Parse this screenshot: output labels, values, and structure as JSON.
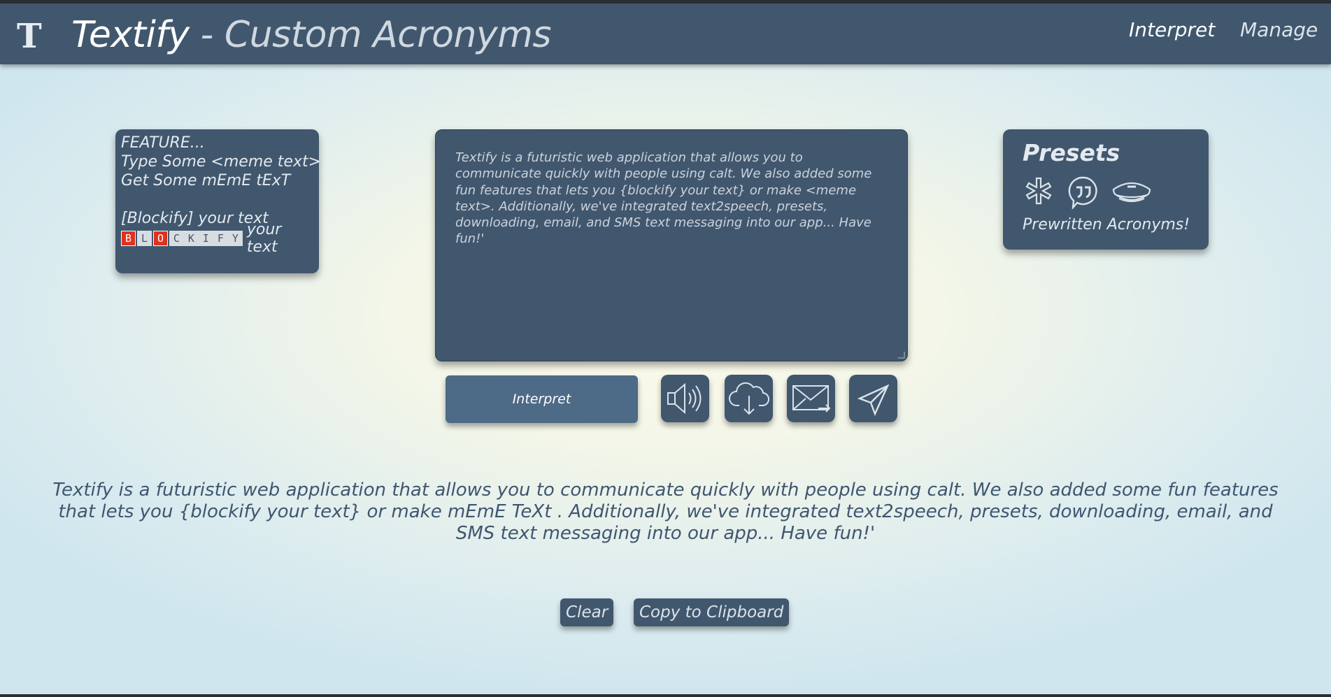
{
  "header": {
    "logo_text": "T",
    "title_main": "Textify",
    "title_sep": " - ",
    "title_sub": "Custom Acronyms",
    "nav": [
      {
        "label": "Interpret"
      },
      {
        "label": "Manage"
      }
    ]
  },
  "feature_card": {
    "line1": "FEATURE...",
    "line2": "Type Some <meme text>",
    "line3": "Get Some mEmE tExT",
    "line4": "[Blockify] your text",
    "blockify_red": [
      "B",
      "O"
    ],
    "blockify_letters": [
      "B",
      "L",
      "O",
      "C",
      "K",
      "I",
      "F",
      "Y"
    ],
    "blockify_tail": "your text"
  },
  "input": {
    "text": "Textify is a futuristic web application that allows you to communicate quickly with people using calt. We also added some fun features that lets you {blockify your text} or make <meme text>. Additionally, we've integrated text2speech, presets, downloading, email, and SMS text messaging into our app... Have fun!'"
  },
  "presets": {
    "title": "Presets",
    "subtitle": "Prewritten Acronyms!",
    "icons": [
      "asterisk-icon",
      "quote-bubble-icon",
      "pilot-cap-icon"
    ]
  },
  "actions": {
    "interpret_label": "Interpret",
    "icons": [
      "speaker-icon",
      "cloud-download-icon",
      "mail-icon",
      "send-icon"
    ]
  },
  "output": {
    "text": "Textify is a futuristic web application that allows you to communicate quickly with people using calt. We also added some fun features that lets you {blockify your text} or make mEmE TeXt . Additionally, we've integrated text2speech, presets, downloading, email, and SMS text messaging into our app... Have fun!'"
  },
  "footer_buttons": {
    "clear_label": "Clear",
    "copy_label": "Copy to Clipboard"
  },
  "colors": {
    "navbar": "#41576e",
    "card": "#41576e",
    "interpret_button": "#4d6a86",
    "blockify_red": "#e0311d"
  }
}
